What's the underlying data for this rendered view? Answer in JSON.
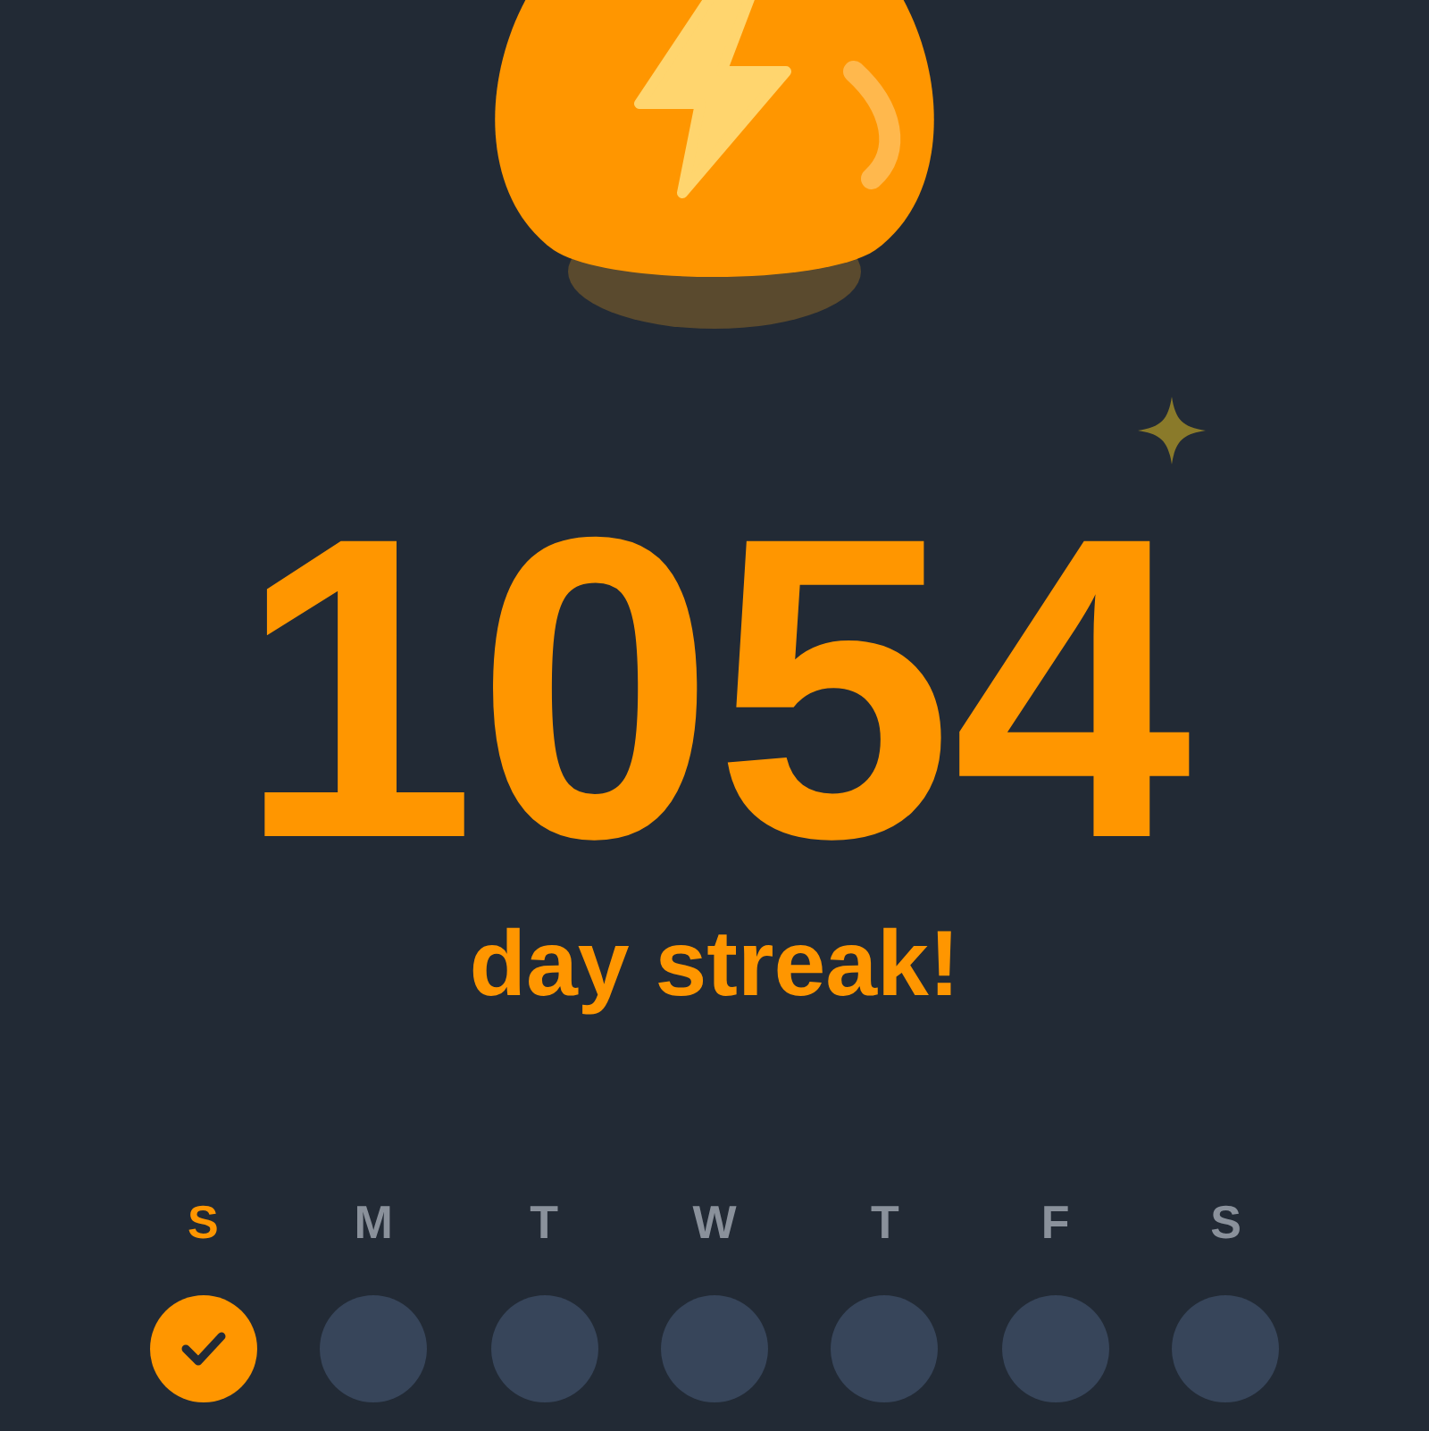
{
  "streak": {
    "count": "1054",
    "caption": "day streak!"
  },
  "days": [
    {
      "label": "S",
      "checked": true
    },
    {
      "label": "M",
      "checked": false
    },
    {
      "label": "T",
      "checked": false
    },
    {
      "label": "W",
      "checked": false
    },
    {
      "label": "T",
      "checked": false
    },
    {
      "label": "F",
      "checked": false
    },
    {
      "label": "S",
      "checked": false
    }
  ]
}
